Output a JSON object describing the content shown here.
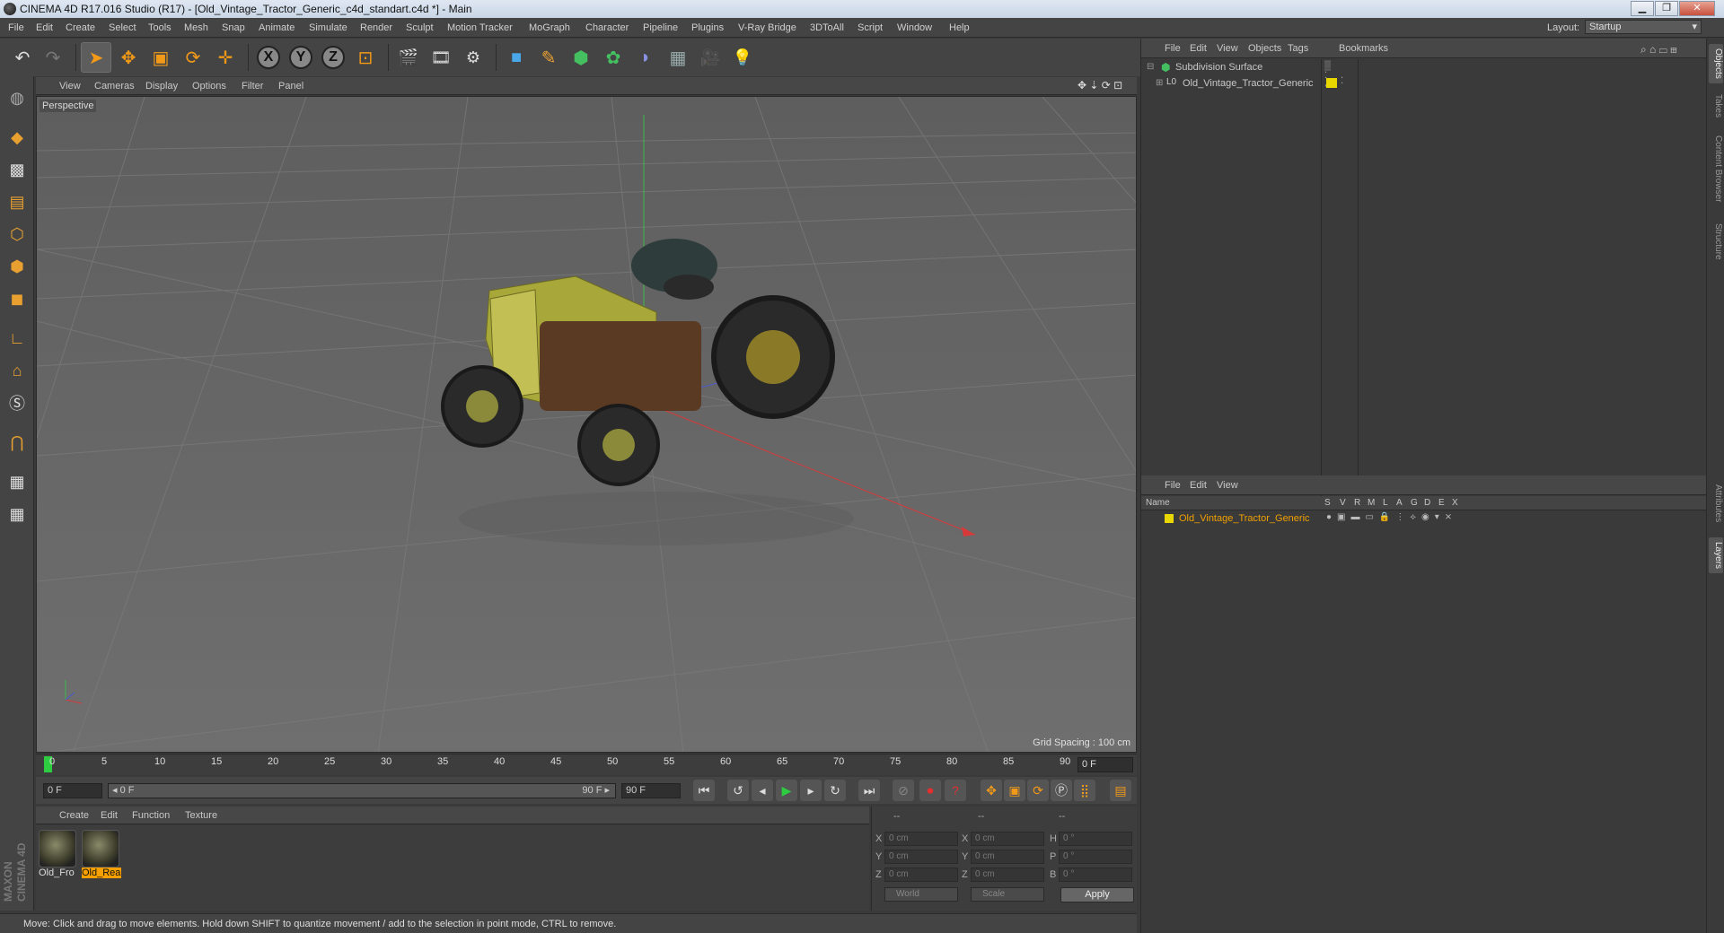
{
  "window": {
    "title": "CINEMA 4D R17.016 Studio (R17) - [Old_Vintage_Tractor_Generic_c4d_standart.c4d *] - Main",
    "minimize": "▁",
    "maximize": "❐",
    "close": "✕"
  },
  "menubar": {
    "items": [
      "File",
      "Edit",
      "Create",
      "Select",
      "Tools",
      "Mesh",
      "Snap",
      "Animate",
      "Simulate",
      "Render",
      "Sculpt",
      "Motion Tracker",
      "MoGraph",
      "Character",
      "Pipeline",
      "Plugins",
      "V-Ray Bridge",
      "3DToAll",
      "Script",
      "Window",
      "Help"
    ],
    "layout_label": "Layout:",
    "layout_value": "Startup"
  },
  "toolbar": {
    "undo": "↶",
    "redo": "↷",
    "select": "➤",
    "move": "✥",
    "scale": "▣",
    "rotate": "⟳",
    "transform": "✛",
    "axis_x": "X",
    "axis_y": "Y",
    "axis_z": "Z",
    "coord": "⊡",
    "render_view": "🎬",
    "render_pv": "🎞",
    "render_settings": "⚙",
    "cube": "■",
    "pen": "✎",
    "subdiv": "⬢",
    "array": "✿",
    "deformer": "◗",
    "floor": "▦",
    "camera": "🎥",
    "light": "💡"
  },
  "viewport": {
    "menu": [
      "View",
      "Cameras",
      "Display",
      "Options",
      "Filter",
      "Panel"
    ],
    "label": "Perspective",
    "grid_spacing": "Grid Spacing : 100 cm"
  },
  "timeline": {
    "ticks": [
      "0",
      "5",
      "10",
      "15",
      "20",
      "25",
      "30",
      "35",
      "40",
      "45",
      "50",
      "55",
      "60",
      "65",
      "70",
      "75",
      "80",
      "85",
      "90"
    ],
    "current_frame": "0 F"
  },
  "transport": {
    "start_field": "0 F",
    "range_start": "◂ 0 F",
    "range_end": "90 F ▸",
    "end_field": "90 F"
  },
  "materials": {
    "menu": [
      "Create",
      "Edit",
      "Function",
      "Texture"
    ],
    "items": [
      {
        "label": "Old_Fro",
        "selected": false
      },
      {
        "label": "Old_Rea",
        "selected": true
      }
    ]
  },
  "coordinates": {
    "header": [
      "--",
      "--",
      "--"
    ],
    "rows": [
      {
        "axis": "X",
        "pos": "0 cm",
        "axis2": "X",
        "size": "0 cm",
        "rot_label": "H",
        "rot": "0 °"
      },
      {
        "axis": "Y",
        "pos": "0 cm",
        "axis2": "Y",
        "size": "0 cm",
        "rot_label": "P",
        "rot": "0 °"
      },
      {
        "axis": "Z",
        "pos": "0 cm",
        "axis2": "Z",
        "size": "0 cm",
        "rot_label": "B",
        "rot": "0 °"
      }
    ],
    "mode_world": "World",
    "mode_scale": "Scale",
    "apply": "Apply"
  },
  "status_bar": "Move: Click and drag to move elements. Hold down SHIFT to quantize movement / add to the selection in point mode, CTRL to remove.",
  "object_manager": {
    "menu": [
      "File",
      "Edit",
      "View",
      "Objects",
      "Tags",
      "Bookmarks"
    ],
    "objects": [
      {
        "name": "Subdivision Surface",
        "indent": 0
      },
      {
        "name": "Old_Vintage_Tractor_Generic",
        "indent": 1
      }
    ]
  },
  "layer_manager": {
    "menu": [
      "File",
      "Edit",
      "View"
    ],
    "columns": [
      "Name",
      "S",
      "V",
      "R",
      "M",
      "L",
      "A",
      "G",
      "D",
      "E",
      "X"
    ],
    "layer_name": "Old_Vintage_Tractor_Generic",
    "layer_color": "#e8d800"
  },
  "side_tabs": [
    "Objects",
    "Takes",
    "Content Browser",
    "Structure",
    "Attributes",
    "Layers"
  ],
  "brand": "MAXON CINEMA 4D",
  "colors": {
    "accent": "#f7a000",
    "layer_text": "#f0a000",
    "tractor_body": "#a8a83a"
  }
}
